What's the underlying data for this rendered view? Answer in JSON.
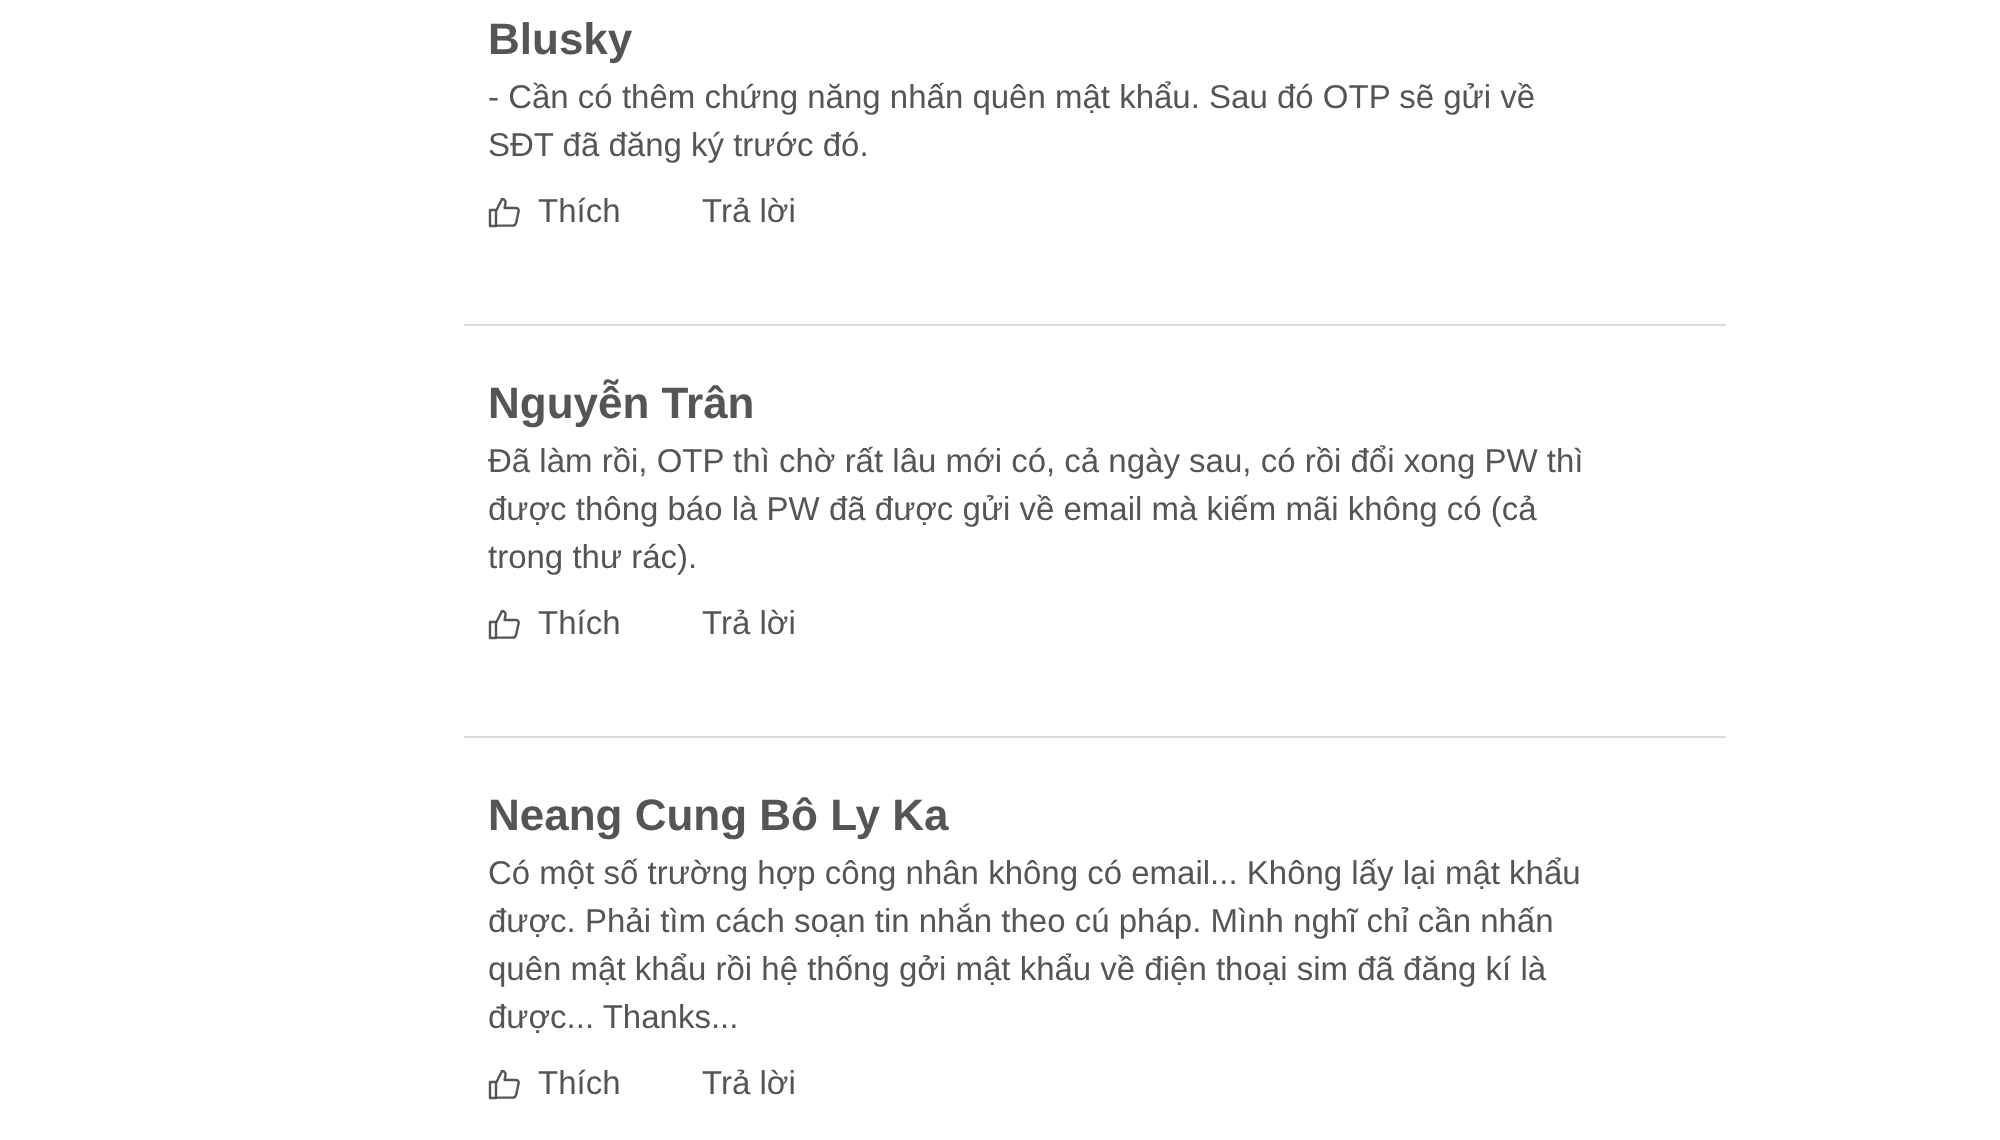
{
  "comments": [
    {
      "author": "Blusky",
      "text": "- Cần có thêm chứng năng nhấn quên mật khẩu. Sau đó OTP sẽ gửi về SĐT đã đăng ký trước đó.",
      "like_label": "Thích",
      "reply_label": "Trả lời"
    },
    {
      "author": "Nguyễn Trân",
      "text": "Đã làm rồi, OTP thì chờ rất lâu mới có, cả ngày sau, có rồi đổi xong PW thì được thông báo là PW đã được gửi về email mà kiếm mãi không có (cả trong thư rác).",
      "like_label": "Thích",
      "reply_label": "Trả lời"
    },
    {
      "author": "Neang Cung Bô Ly Ka",
      "text": "Có một số trường hợp công nhân không có email... Không lấy lại mật khẩu được. Phải tìm cách soạn tin nhắn theo cú pháp. Mình nghĩ chỉ cần nhấn quên mật khẩu rồi hệ thống gởi mật khẩu về điện thoại sim đã đăng kí là được... Thanks...",
      "like_label": "Thích",
      "reply_label": "Trả lời"
    }
  ]
}
